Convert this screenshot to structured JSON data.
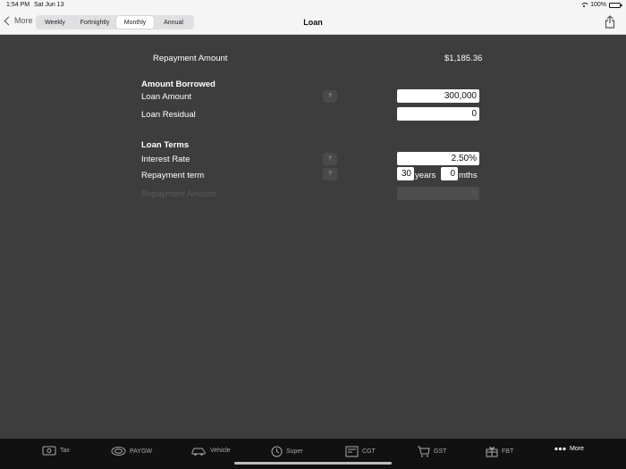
{
  "status": {
    "time": "1:54 PM",
    "date": "Sat Jun 13",
    "battery": "100%"
  },
  "nav": {
    "back_label": "More",
    "title": "Loan",
    "segments": [
      "Weekly",
      "Fortnightly",
      "Monthly",
      "Annual"
    ],
    "selected_segment": "Monthly"
  },
  "summary": {
    "label": "Repayment Amount",
    "value": "$1,185.36"
  },
  "borrowed": {
    "heading": "Amount Borrowed",
    "loan_amount_label": "Loan Amount",
    "loan_amount_value": "300,000",
    "loan_residual_label": "Loan Residual",
    "loan_residual_value": "0"
  },
  "terms": {
    "heading": "Loan Terms",
    "interest_label": "Interest Rate",
    "interest_value": "2.50%",
    "term_label": "Repayment term",
    "term_years_value": "30",
    "years_unit": "years",
    "term_months_value": "0",
    "months_unit": "mths",
    "repayment_label": "Repayment Amount",
    "repayment_value": "0"
  },
  "help_label": "?",
  "tabs": [
    {
      "label": "Tax",
      "icon": "banknote-icon"
    },
    {
      "label": "PAYGW",
      "icon": "coins-icon"
    },
    {
      "label": "Vehicle",
      "icon": "car-icon"
    },
    {
      "label": "Super",
      "icon": "piggy-clock-icon"
    },
    {
      "label": "CGT",
      "icon": "calculator-icon"
    },
    {
      "label": "GST",
      "icon": "cart-icon"
    },
    {
      "label": "FBT",
      "icon": "gift-icon"
    },
    {
      "label": "More",
      "icon": "more-dots-icon"
    }
  ],
  "colors": {
    "background": "#3d3d3d",
    "bar": "#f5f5f5",
    "tabbar": "#111111",
    "active_tab": "#ffffff"
  }
}
